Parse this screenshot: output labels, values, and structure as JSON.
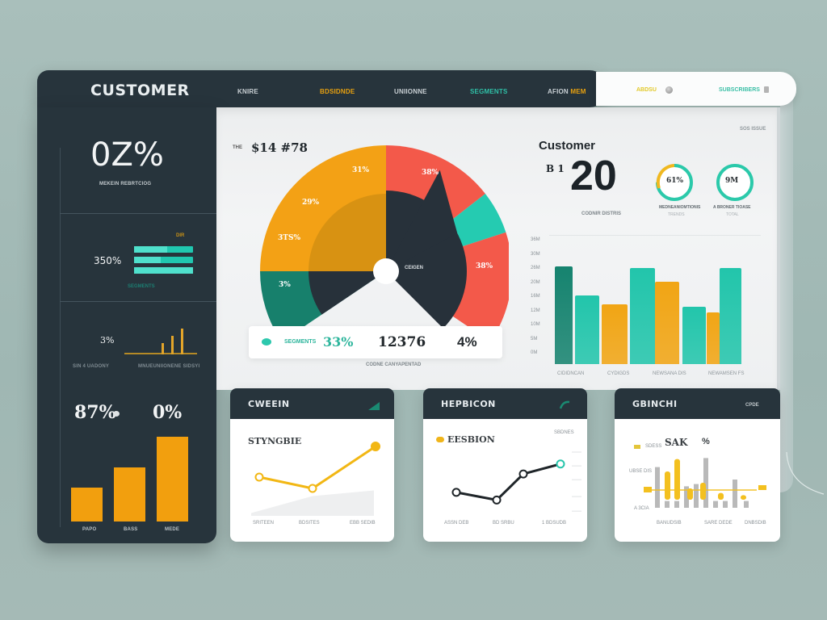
{
  "header": {
    "brand": "CUSTOMER",
    "nav": [
      {
        "label": "KNIRE",
        "color": "#c9d0d4"
      },
      {
        "label": "BDSIDNDE",
        "color": "#e8a10f"
      },
      {
        "label": "UNIIONNE",
        "color": "#c9d0d4"
      },
      {
        "label": "SEGMENTS",
        "color": "#2fc0a7"
      },
      {
        "label": "AFION",
        "highlight": "MEM",
        "color": "#c9d0d4",
        "highlight_color": "#e8a10f"
      }
    ],
    "right": {
      "left_label": "ABDSU",
      "right_label": "SUBSCRIBERS"
    }
  },
  "sidebar": {
    "kpi_main": {
      "value": "0Z%",
      "caption": "MEKEIN REBRTCIOG"
    },
    "kpi_bars": {
      "value": "350%",
      "tag": "DIR",
      "caption": "SEGMENTS",
      "fills": [
        0.56,
        0.45,
        1.0
      ]
    },
    "kpi_spark": {
      "value": "3%",
      "left_caption": "SIN 4 UADONY",
      "right_caption": "MNUEUNIIONENE SIDSYI",
      "spark_values": [
        0,
        0,
        0,
        0.35,
        0.58,
        0.8
      ]
    },
    "kpi_duo": {
      "left_value": "87%",
      "right_value": "0%"
    },
    "bar_chart": {
      "categories": [
        "PAPO",
        "BASS",
        "MEDE"
      ],
      "values": [
        40,
        64,
        100
      ]
    }
  },
  "main": {
    "gauge_title_small": "THE",
    "gauge_title": "$14 #78",
    "top_right_tag": "SOS ISSUE",
    "gauge": {
      "outer": [
        {
          "label": "31%",
          "color": "#f3a115",
          "start": 0,
          "end": 90
        },
        {
          "label": "38%",
          "color": "#f3594a",
          "start": 90,
          "end": 142
        },
        {
          "label": "",
          "color": "#25cbb1",
          "start": 142,
          "end": 162
        },
        {
          "label": "38%",
          "color": "#f3594a",
          "start": 162,
          "end": 210
        },
        {
          "label": "3%",
          "color": "#17806c",
          "start": -90,
          "end": 0
        }
      ],
      "outer_labels_extra": [
        "29%",
        "3TS%"
      ],
      "inner_label": "CEIGEN"
    },
    "legend": {
      "dot_color": "#2dc8ad",
      "name": "SEGMENTS",
      "pct": "33%",
      "count": "12376",
      "share": "4%",
      "caption": "CODNE CANYAPENTAD"
    },
    "customer": {
      "heading": "Customer",
      "prefix": "B 1",
      "big_number": "20",
      "caption": "CODNIR DISTRIS",
      "rings": [
        {
          "value": "61%",
          "caption": "MEDNEANIOMTIONIS",
          "sub": "TRENDS",
          "progress": 0.75
        },
        {
          "value": "9M",
          "caption": "A BRONER TIOASE",
          "sub": "TOTAL",
          "progress": 1.0
        }
      ]
    },
    "bar_chart": {
      "y_labels": [
        "36M",
        "30M",
        "26M",
        "20M",
        "16M",
        "12M",
        "10M",
        "5M",
        "0M"
      ],
      "x_labels": [
        "CIDIDNCAN",
        "CYDIGDS",
        "NEWSANA DIS",
        "NEWAMSEN FS"
      ],
      "bars": [
        {
          "value": 100,
          "color": "#16836f"
        },
        {
          "value": 70,
          "color": "#22c5ab"
        },
        {
          "value": 61,
          "color": "#f1a514"
        },
        {
          "value": 98,
          "color": "#22c5ab"
        },
        {
          "value": 84,
          "color": "#f1a514"
        },
        {
          "value": 59,
          "color": "#22c5ab"
        },
        {
          "value": 53,
          "color": "#f1a514"
        },
        {
          "value": 98,
          "color": "#22c5ab"
        }
      ]
    }
  },
  "cards": [
    {
      "title": "CWEEIN",
      "subtitle": "STYNGBIE",
      "x_labels": [
        "SRITEEN",
        "BDSITES",
        "EBB SEDIB"
      ],
      "line_values": [
        0.52,
        0.38,
        0.9
      ],
      "area_values": [
        0.05,
        0.35,
        0.45
      ],
      "line_color": "#f2b714"
    },
    {
      "title": "HEPBICON",
      "subtitle": "EESBION",
      "tag": "SBDNES",
      "x_labels": [
        "ASSN DEB",
        "BD SRBU",
        "1 BDSUDB"
      ],
      "line_values": [
        0.38,
        0.28,
        0.62,
        0.75
      ],
      "line_color": "#1f2529",
      "end_color": "#27c5ab"
    },
    {
      "title": "GBINCHI",
      "tag": "CPDE",
      "headline": "SAK",
      "headline_pct": "%",
      "legend_labels": [
        "SDESS",
        "UBSE DIS",
        "A 3CIA"
      ],
      "x_labels": [
        "BANUDSIB",
        "SARE DEDE",
        "DNBSDIB"
      ],
      "gray_values": [
        0.72,
        0.12,
        0.05,
        0.38,
        0.42,
        0.88,
        0.1,
        0.1,
        0.5,
        0.12
      ],
      "gold_values": [
        0.5,
        0.72,
        0.2,
        0.3,
        0.12,
        0.08
      ],
      "gray_color": "#b9b9b9",
      "gold_color": "#f3c01f"
    }
  ]
}
